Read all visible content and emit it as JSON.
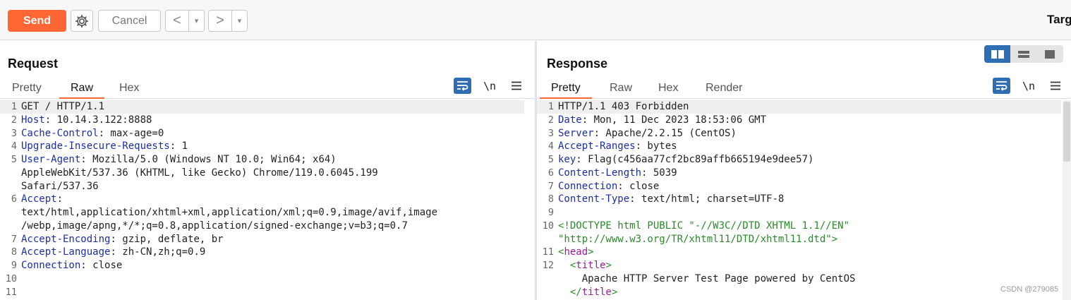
{
  "toolbar": {
    "send_label": "Send",
    "cancel_label": "Cancel",
    "back_glyph": "<",
    "forward_glyph": ">",
    "dropdown_glyph": "▾",
    "target_label": "Targ",
    "accent_color": "#ff6633"
  },
  "request": {
    "title": "Request",
    "tabs": [
      {
        "label": "Pretty",
        "active": false
      },
      {
        "label": "Raw",
        "active": true
      },
      {
        "label": "Hex",
        "active": false
      }
    ],
    "newline_toggle": "\\n",
    "lines": [
      {
        "n": "1",
        "parts": [
          {
            "t": "GET / HTTP/1.1",
            "c": ""
          }
        ]
      },
      {
        "n": "2",
        "parts": [
          {
            "t": "Host",
            "c": "k"
          },
          {
            "t": ": 10.14.3.122:8888",
            "c": ""
          }
        ]
      },
      {
        "n": "3",
        "parts": [
          {
            "t": "Cache-Control",
            "c": "k"
          },
          {
            "t": ": max-age=0",
            "c": ""
          }
        ]
      },
      {
        "n": "4",
        "parts": [
          {
            "t": "Upgrade-Insecure-Requests",
            "c": "k"
          },
          {
            "t": ": 1",
            "c": ""
          }
        ]
      },
      {
        "n": "5",
        "parts": [
          {
            "t": "User-Agent",
            "c": "k"
          },
          {
            "t": ": Mozilla/5.0 (Windows NT 10.0; Win64; x64)",
            "c": ""
          }
        ]
      },
      {
        "n": "",
        "parts": [
          {
            "t": "AppleWebKit/537.36 (KHTML, like Gecko) Chrome/119.0.6045.199",
            "c": ""
          }
        ]
      },
      {
        "n": "",
        "parts": [
          {
            "t": "Safari/537.36",
            "c": ""
          }
        ]
      },
      {
        "n": "6",
        "parts": [
          {
            "t": "Accept",
            "c": "k"
          },
          {
            "t": ":",
            "c": ""
          }
        ]
      },
      {
        "n": "",
        "parts": [
          {
            "t": "text/html,application/xhtml+xml,application/xml;q=0.9,image/avif,image",
            "c": ""
          }
        ]
      },
      {
        "n": "",
        "parts": [
          {
            "t": "/webp,image/apng,*/*;q=0.8,application/signed-exchange;v=b3;q=0.7",
            "c": ""
          }
        ]
      },
      {
        "n": "7",
        "parts": [
          {
            "t": "Accept-Encoding",
            "c": "k"
          },
          {
            "t": ": gzip, deflate, br",
            "c": ""
          }
        ]
      },
      {
        "n": "8",
        "parts": [
          {
            "t": "Accept-Language",
            "c": "k"
          },
          {
            "t": ": zh-CN,zh;q=0.9",
            "c": ""
          }
        ]
      },
      {
        "n": "9",
        "parts": [
          {
            "t": "Connection",
            "c": "k"
          },
          {
            "t": ": close",
            "c": ""
          }
        ]
      },
      {
        "n": "10",
        "parts": [
          {
            "t": "",
            "c": ""
          }
        ]
      },
      {
        "n": "11",
        "parts": [
          {
            "t": "",
            "c": ""
          }
        ]
      }
    ]
  },
  "response": {
    "title": "Response",
    "tabs": [
      {
        "label": "Pretty",
        "active": true
      },
      {
        "label": "Raw",
        "active": false
      },
      {
        "label": "Hex",
        "active": false
      },
      {
        "label": "Render",
        "active": false
      }
    ],
    "newline_toggle": "\\n",
    "lines": [
      {
        "n": "1",
        "parts": [
          {
            "t": "HTTP/1.1 403 Forbidden",
            "c": ""
          }
        ]
      },
      {
        "n": "2",
        "parts": [
          {
            "t": "Date",
            "c": "k"
          },
          {
            "t": ": Mon, 11 Dec 2023 18:53:06 GMT",
            "c": ""
          }
        ]
      },
      {
        "n": "3",
        "parts": [
          {
            "t": "Server",
            "c": "k"
          },
          {
            "t": ": Apache/2.2.15 (CentOS)",
            "c": ""
          }
        ]
      },
      {
        "n": "4",
        "parts": [
          {
            "t": "Accept-Ranges",
            "c": "k"
          },
          {
            "t": ": bytes",
            "c": ""
          }
        ]
      },
      {
        "n": "5",
        "parts": [
          {
            "t": "key",
            "c": "k"
          },
          {
            "t": ": Flag(c456aa77cf2bc89affb665194e9dee57)",
            "c": ""
          }
        ]
      },
      {
        "n": "6",
        "parts": [
          {
            "t": "Content-Length",
            "c": "k"
          },
          {
            "t": ": 5039",
            "c": ""
          }
        ]
      },
      {
        "n": "7",
        "parts": [
          {
            "t": "Connection",
            "c": "k"
          },
          {
            "t": ": close",
            "c": ""
          }
        ]
      },
      {
        "n": "8",
        "parts": [
          {
            "t": "Content-Type",
            "c": "k"
          },
          {
            "t": ": text/html; charset=UTF-8",
            "c": ""
          }
        ]
      },
      {
        "n": "9",
        "parts": [
          {
            "t": "",
            "c": ""
          }
        ]
      },
      {
        "n": "10",
        "parts": [
          {
            "t": "<!DOCTYPE html PUBLIC \"-//W3C//DTD XHTML 1.1//EN\"",
            "c": "dt"
          }
        ]
      },
      {
        "n": "",
        "parts": [
          {
            "t": "\"http://www.w3.org/TR/xhtml11/DTD/xhtml11.dtd\">",
            "c": "dt"
          }
        ]
      },
      {
        "n": "11",
        "parts": [
          {
            "t": "<",
            "c": "str"
          },
          {
            "t": "head",
            "c": "tag"
          },
          {
            "t": ">",
            "c": "str"
          }
        ]
      },
      {
        "n": "12",
        "parts": [
          {
            "t": "  <",
            "c": "str"
          },
          {
            "t": "title",
            "c": "tag"
          },
          {
            "t": ">",
            "c": "str"
          }
        ]
      },
      {
        "n": "",
        "parts": [
          {
            "t": "    Apache HTTP Server Test Page powered by CentOS",
            "c": ""
          }
        ]
      },
      {
        "n": "",
        "parts": [
          {
            "t": "  </",
            "c": "str"
          },
          {
            "t": "title",
            "c": "tag"
          },
          {
            "t": ">",
            "c": "str"
          }
        ]
      }
    ]
  },
  "watermark": "CSDN @279085"
}
